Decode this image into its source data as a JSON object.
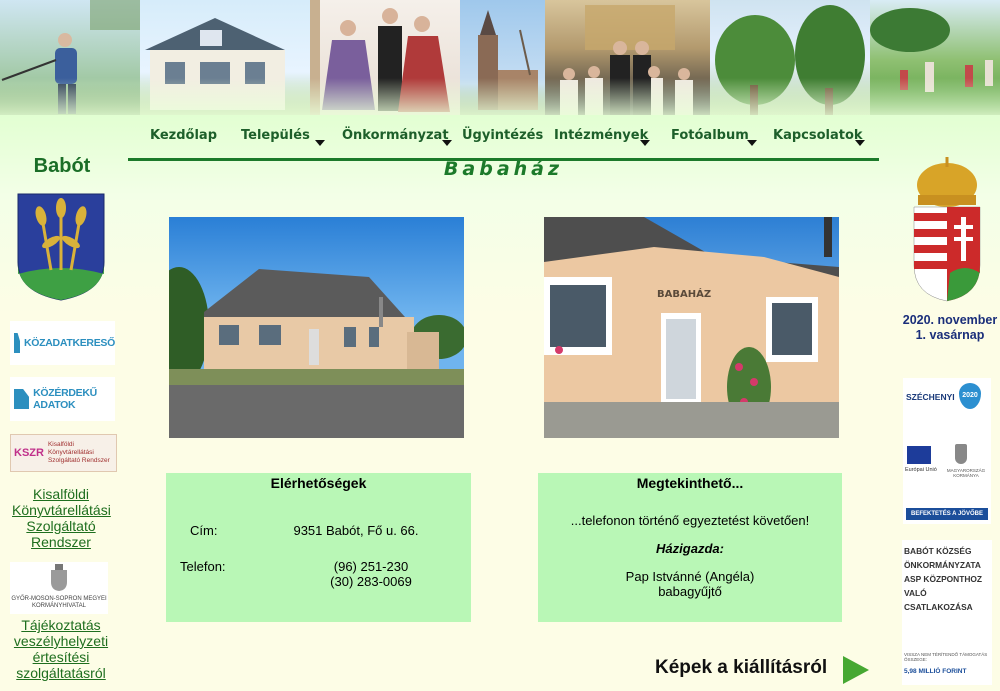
{
  "site": {
    "name": "Babót"
  },
  "nav": {
    "items": [
      {
        "label": "Kezdőlap",
        "dropdown": false
      },
      {
        "label": "Település",
        "dropdown": true
      },
      {
        "label": "Önkormányzat",
        "dropdown": true
      },
      {
        "label": "Ügyintézés",
        "dropdown": false
      },
      {
        "label": "Intézmények",
        "dropdown": true
      },
      {
        "label": "Fotóalbum",
        "dropdown": true
      },
      {
        "label": "Kapcsolatok",
        "dropdown": true
      }
    ]
  },
  "page": {
    "title": "Babaház"
  },
  "left": {
    "banners": [
      {
        "label": "KÖZADATKERESŐ",
        "icon": "document-icon"
      },
      {
        "label": "KÖZÉRDEKŰ ADATOK",
        "icon": "document-icon"
      },
      {
        "label": "Kisalföldi Könyvtárellátási Szolgáltató Rendszer",
        "short": "KSZR"
      }
    ],
    "library_link": "Kisalföldi Könyvtárellátási Szolgáltató Rendszer",
    "gov_office": "GYŐR-MOSON-SOPRON MEGYEI KORMÁNYHIVATAL",
    "emergency_link": "Tájékoztatás veszélyhelyzeti értesítési szolgáltatásról"
  },
  "right": {
    "date_line1": "2020. november",
    "date_line2": "1. vasárnap",
    "szechenyi_label": "SZÉCHENYI",
    "szechenyi_plan": "2020",
    "eu_label": "Európai Unió",
    "gov_label": "MAGYARORSZÁG KORMÁNYA",
    "invest_label": "BEFEKTETÉS A JÖVŐBE",
    "asp_text": "BABÓT KÖZSÉG ÖNKORMÁNYZATA ASP KÖZPONTHOZ VALÓ CSATLAKOZÁSA",
    "asp_small": "VISSZA NEM TÉRÍTENDŐ TÁMOGATÁS ÖSSZEGE:",
    "asp_amount": "5,98 MILLIÓ FORINT"
  },
  "photo2_sign": "BABAHÁZ",
  "contact": {
    "heading": "Elérhetőségek",
    "address_label": "Cím:",
    "address": "9351 Babót, Fő u. 66.",
    "phone_label": "Telefon:",
    "phone1": "(96) 251-230",
    "phone2": "(30) 283-0069"
  },
  "visit": {
    "heading": "Megtekinthető...",
    "note": "...telefonon történő egyeztetést követően!",
    "host_label": "Házigazda:",
    "host_name": "Pap Istvánné (Angéla)",
    "host_title": "babagyűjtő"
  },
  "gallery_link": "Képek a kiállításról",
  "colors": {
    "nav_text": "#1d5f2a",
    "accent_green": "#1c7a2a",
    "box_bg": "#b9f7b6",
    "link": "#1e6e1e",
    "date": "#1a2e7a"
  }
}
